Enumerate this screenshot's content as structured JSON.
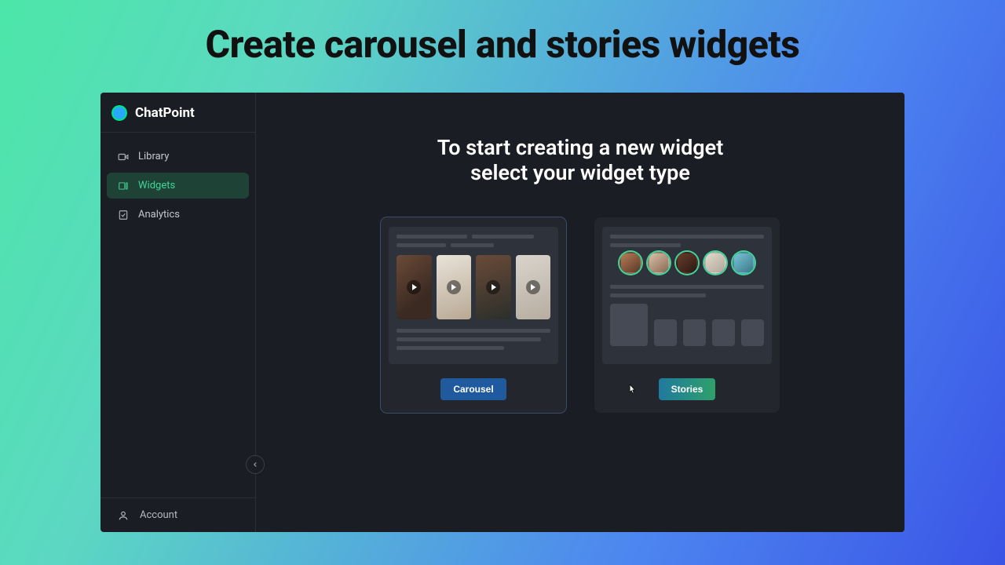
{
  "hero": {
    "title": "Create carousel and stories widgets"
  },
  "brand": {
    "name": "ChatPoint"
  },
  "sidebar": {
    "items": [
      {
        "label": "Library"
      },
      {
        "label": "Widgets"
      },
      {
        "label": "Analytics"
      }
    ],
    "footer_label": "Account"
  },
  "main": {
    "heading_line1": "To start creating a new widget",
    "heading_line2": "select your widget type"
  },
  "cards": {
    "carousel_label": "Carousel",
    "stories_label": "Stories"
  }
}
